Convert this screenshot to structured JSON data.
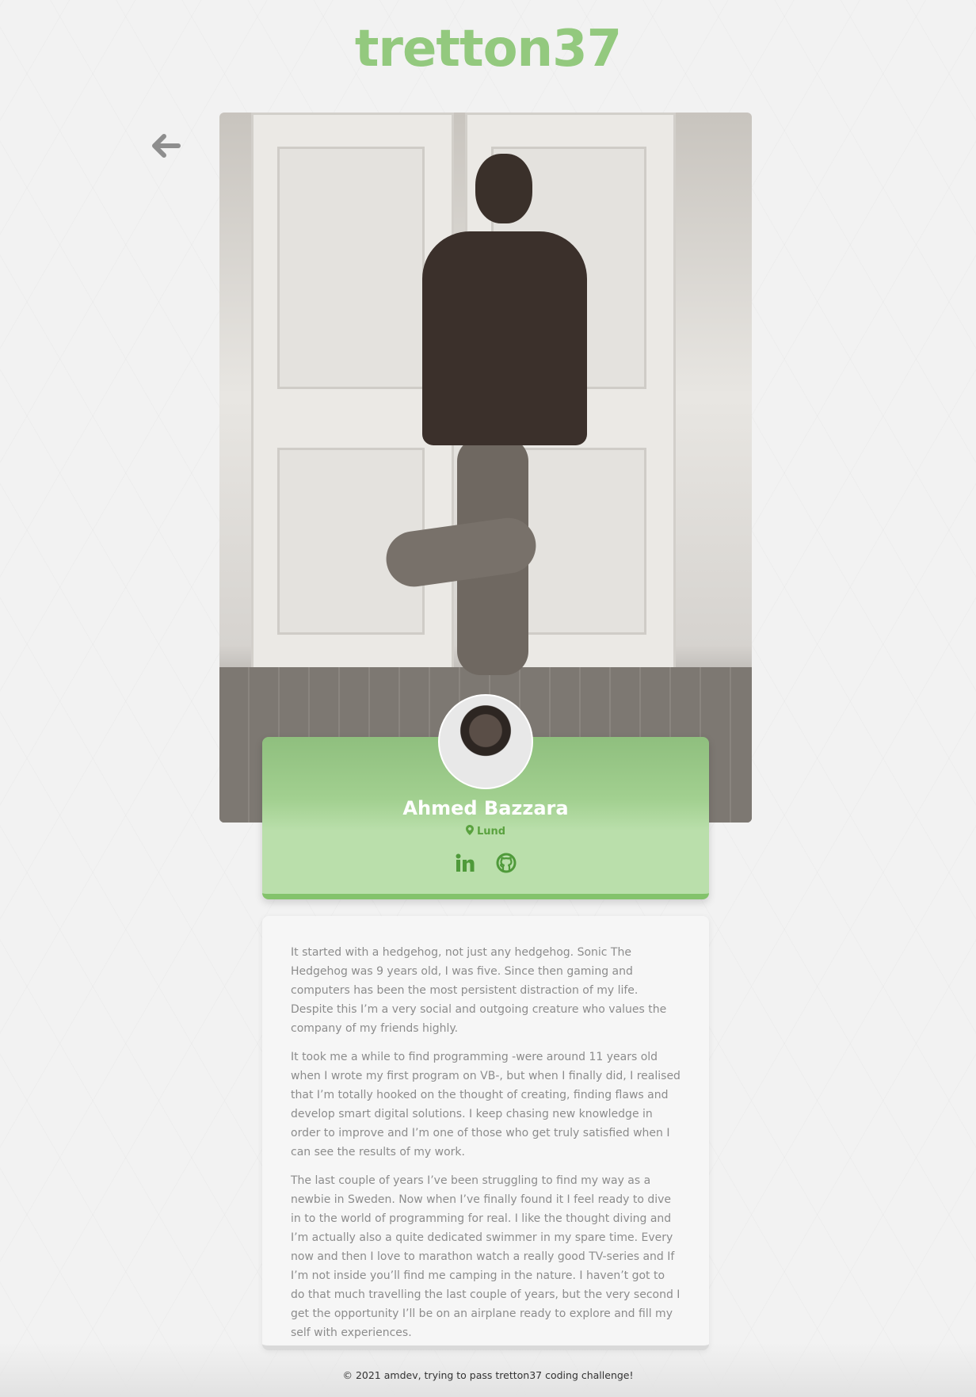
{
  "brand": {
    "logo_text": "tretton37",
    "accent_color": "#93c97e"
  },
  "nav": {
    "back_icon": "arrow-left-icon"
  },
  "profile": {
    "name": "Ahmed Bazzara",
    "location": "Lund",
    "location_icon": "map-pin-icon",
    "socials": [
      {
        "icon": "linkedin-icon",
        "label": "in"
      },
      {
        "icon": "github-icon"
      }
    ]
  },
  "bio": {
    "paragraphs": [
      "It started with a hedgehog, not just any hedgehog. Sonic The Hedgehog was 9 years old, I was five. Since then gaming and computers has been the most persistent distraction of my life. Despite this I’m a very social and outgoing creature who values the company of my friends highly.",
      "It took me a while to find programming -were around 11 years old when I wrote my first program on VB-, but when I finally did, I realised that I’m totally hooked on the thought of creating, finding flaws and develop smart digital solutions. I keep chasing new knowledge in order to improve and I’m one of those who get truly satisfied when I can see the results of my work.",
      "The last couple of years I’ve been struggling to find my way as a newbie in Sweden. Now when I’ve finally found it I feel ready to dive in to the world of programming for real. I like the thought diving and I’m actually also a quite dedicated swimmer in my spare time. Every now and then I love to marathon watch a really good TV-series and If I’m not inside you’ll find me camping in the nature. I haven’t got to do that much travelling the last couple of years, but the very second I get the opportunity I’ll be on an airplane ready to explore and fill my self with experiences."
    ]
  },
  "footer": {
    "text": "© 2021 amdev, trying to pass tretton37 coding challenge!"
  }
}
